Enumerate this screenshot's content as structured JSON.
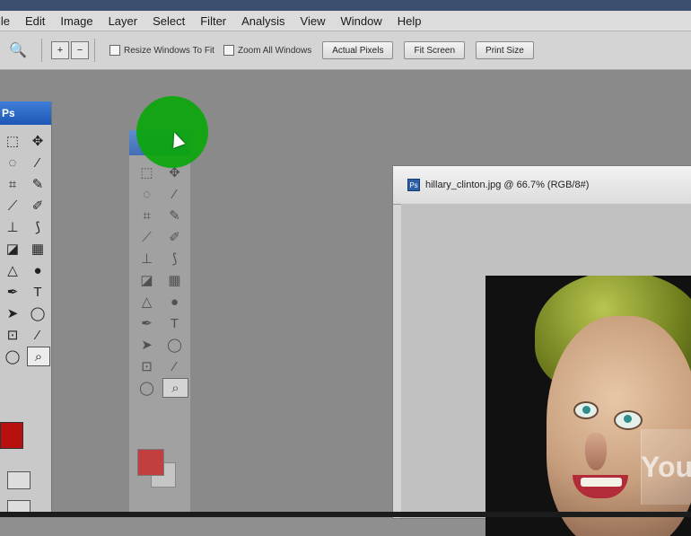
{
  "menu": {
    "items": [
      "ile",
      "Edit",
      "Image",
      "Layer",
      "Select",
      "Filter",
      "Analysis",
      "View",
      "Window",
      "Help"
    ]
  },
  "options": {
    "tool_symbol": "🔍",
    "zoom_in_symbol": "+",
    "zoom_out_symbol": "−",
    "resize_label": "Resize Windows To Fit",
    "zoom_all_label": "Zoom All Windows",
    "actual_pixels": "Actual Pixels",
    "fit_screen": "Fit Screen",
    "print_size": "Print Size"
  },
  "left_panel": {
    "header": "Ps"
  },
  "document": {
    "title": "hillary_clinton.jpg @ 66.7% (RGB/8#)"
  },
  "watermark": {
    "text": "You"
  },
  "colors": {
    "accent": "#2e5fa3",
    "foreground": "#b80f0f",
    "highlight_circle": "#0ba60b"
  }
}
